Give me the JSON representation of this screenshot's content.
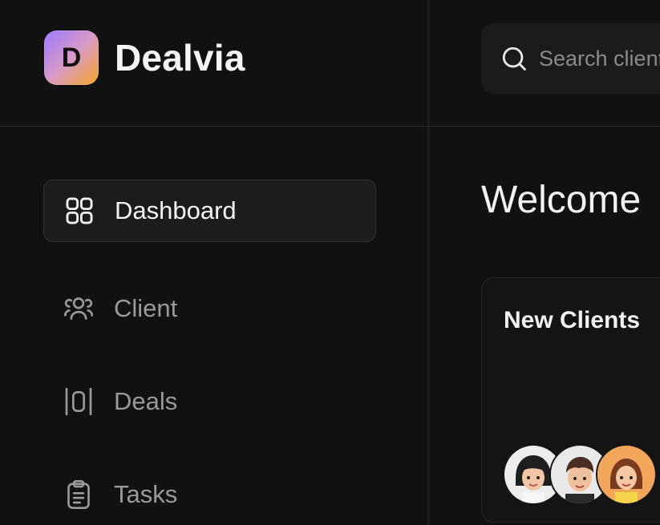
{
  "app": {
    "name": "Dealvia",
    "logo_letter": "D"
  },
  "search": {
    "placeholder": "Search clients"
  },
  "sidebar": {
    "items": [
      {
        "label": "Dashboard",
        "icon": "dashboard-grid-icon",
        "active": true
      },
      {
        "label": "Client",
        "icon": "users-icon",
        "active": false
      },
      {
        "label": "Deals",
        "icon": "deals-columns-icon",
        "active": false
      },
      {
        "label": "Tasks",
        "icon": "clipboard-icon",
        "active": false
      }
    ]
  },
  "main": {
    "welcome": "Welcome",
    "new_clients_card": {
      "title": "New Clients"
    }
  },
  "colors": {
    "background": "#111111",
    "logo_gradient_start": "#9b7bff",
    "logo_gradient_end": "#f5a623"
  }
}
